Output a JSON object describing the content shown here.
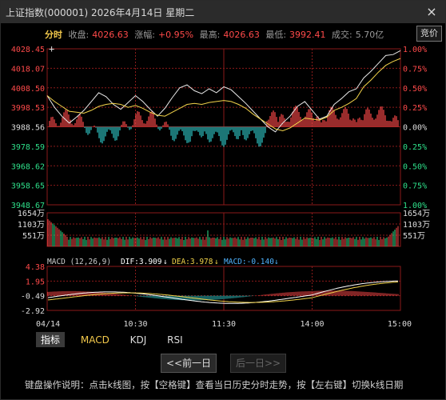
{
  "window": {
    "title": "上证指数(000001) 2026年4月14日 星期二",
    "close": "×"
  },
  "info": {
    "mode": "分时",
    "close_label": "收盘:",
    "close_value": "4026.63",
    "change_label": "涨幅:",
    "change_value": "+0.95%",
    "high_label": "最高:",
    "high_value": "4026.63",
    "low_label": "最低:",
    "low_value": "3992.41",
    "volume_label": "成交:",
    "volume_value": "5.70亿",
    "bid_button": "竞价"
  },
  "price_axis": {
    "left": [
      "4028.45",
      "4018.07",
      "4008.50",
      "3998.53",
      "3988.56",
      "3978.59",
      "3968.62",
      "3958.65",
      "3948.67"
    ],
    "right": [
      "1.00%",
      "0.75%",
      "0.50%",
      "0.25%",
      "0.00%",
      "0.25%",
      "0.50%",
      "0.75%",
      "1.00%"
    ]
  },
  "volume_axis": {
    "left": [
      "1654万",
      "1103万",
      "551万"
    ],
    "right": [
      "1654万",
      "1103万",
      "551万"
    ]
  },
  "macd": {
    "label": "MACD (12,26,9)",
    "dif": "DIF:3.909",
    "dea": "DEA:3.978",
    "macd": "MACD:-0.140",
    "axis": [
      "4.38",
      "1.95",
      "-0.49",
      "-2.92"
    ]
  },
  "time_axis": [
    "04/14",
    "10:30",
    "11:30",
    "14:00",
    "15:00"
  ],
  "indicator_tabs": [
    "指标",
    "MACD",
    "KDJ",
    "RSI"
  ],
  "nav": {
    "prev": "<<前一日",
    "next": "后一日>>"
  },
  "help_text": "键盘操作说明：点击k线图，按【空格键】查看当日历史分时走势，按【左右键】切换k线日期",
  "colors": {
    "up": "#ff4a4a",
    "down": "#2ec4c4",
    "price_line": "#e8e8e8",
    "avg_line": "#f2d34a",
    "grid": "#8b1a1a"
  },
  "chart_data": {
    "type": "line",
    "series": [
      {
        "values": [
          4004.5,
          3998.5,
          3994.0,
          3990.5,
          3993.5,
          3997.0,
          4001.5,
          4006.0,
          4004.0,
          4000.0,
          3997.5,
          4001.0,
          4004.5,
          4001.5,
          3997.5,
          3994.0,
          3998.0,
          4003.5,
          4008.5,
          4010.0,
          4007.0,
          4005.5,
          4008.0,
          4006.0,
          4009.0,
          4007.5,
          4004.0,
          4000.5,
          3996.5,
          3992.5,
          3988.5,
          3986.0,
          3990.5,
          3994.0,
          3999.0,
          4001.5,
          3997.0,
          3992.5,
          3994.0,
          4000.0,
          4003.0,
          4006.5,
          4008.0,
          4013.5,
          4017.0,
          4021.0,
          4025.0,
          4025.5,
          4027.5
        ]
      },
      {
        "values": [
          4004.5,
          4001.5,
          3999.0,
          3996.5,
          3996.0,
          3995.5,
          3997.0,
          3999.0,
          4000.0,
          4000.5,
          4000.0,
          3998.5,
          3999.5,
          3998.0,
          3996.0,
          3994.5,
          3994.0,
          3996.0,
          3998.0,
          4000.0,
          4000.5,
          4000.0,
          4001.0,
          4001.5,
          4002.0,
          4001.5,
          4000.0,
          3998.0,
          3995.0,
          3992.5,
          3990.0,
          3987.5,
          3986.5,
          3988.0,
          3990.5,
          3993.0,
          3992.5,
          3992.0,
          3993.5,
          3997.0,
          3998.5,
          4000.5,
          4003.0,
          4009.0,
          4012.5,
          4016.5,
          4020.0,
          4022.0,
          4023.5
        ]
      }
    ],
    "ylim": [
      3948.67,
      4028.45
    ],
    "grid": true
  }
}
